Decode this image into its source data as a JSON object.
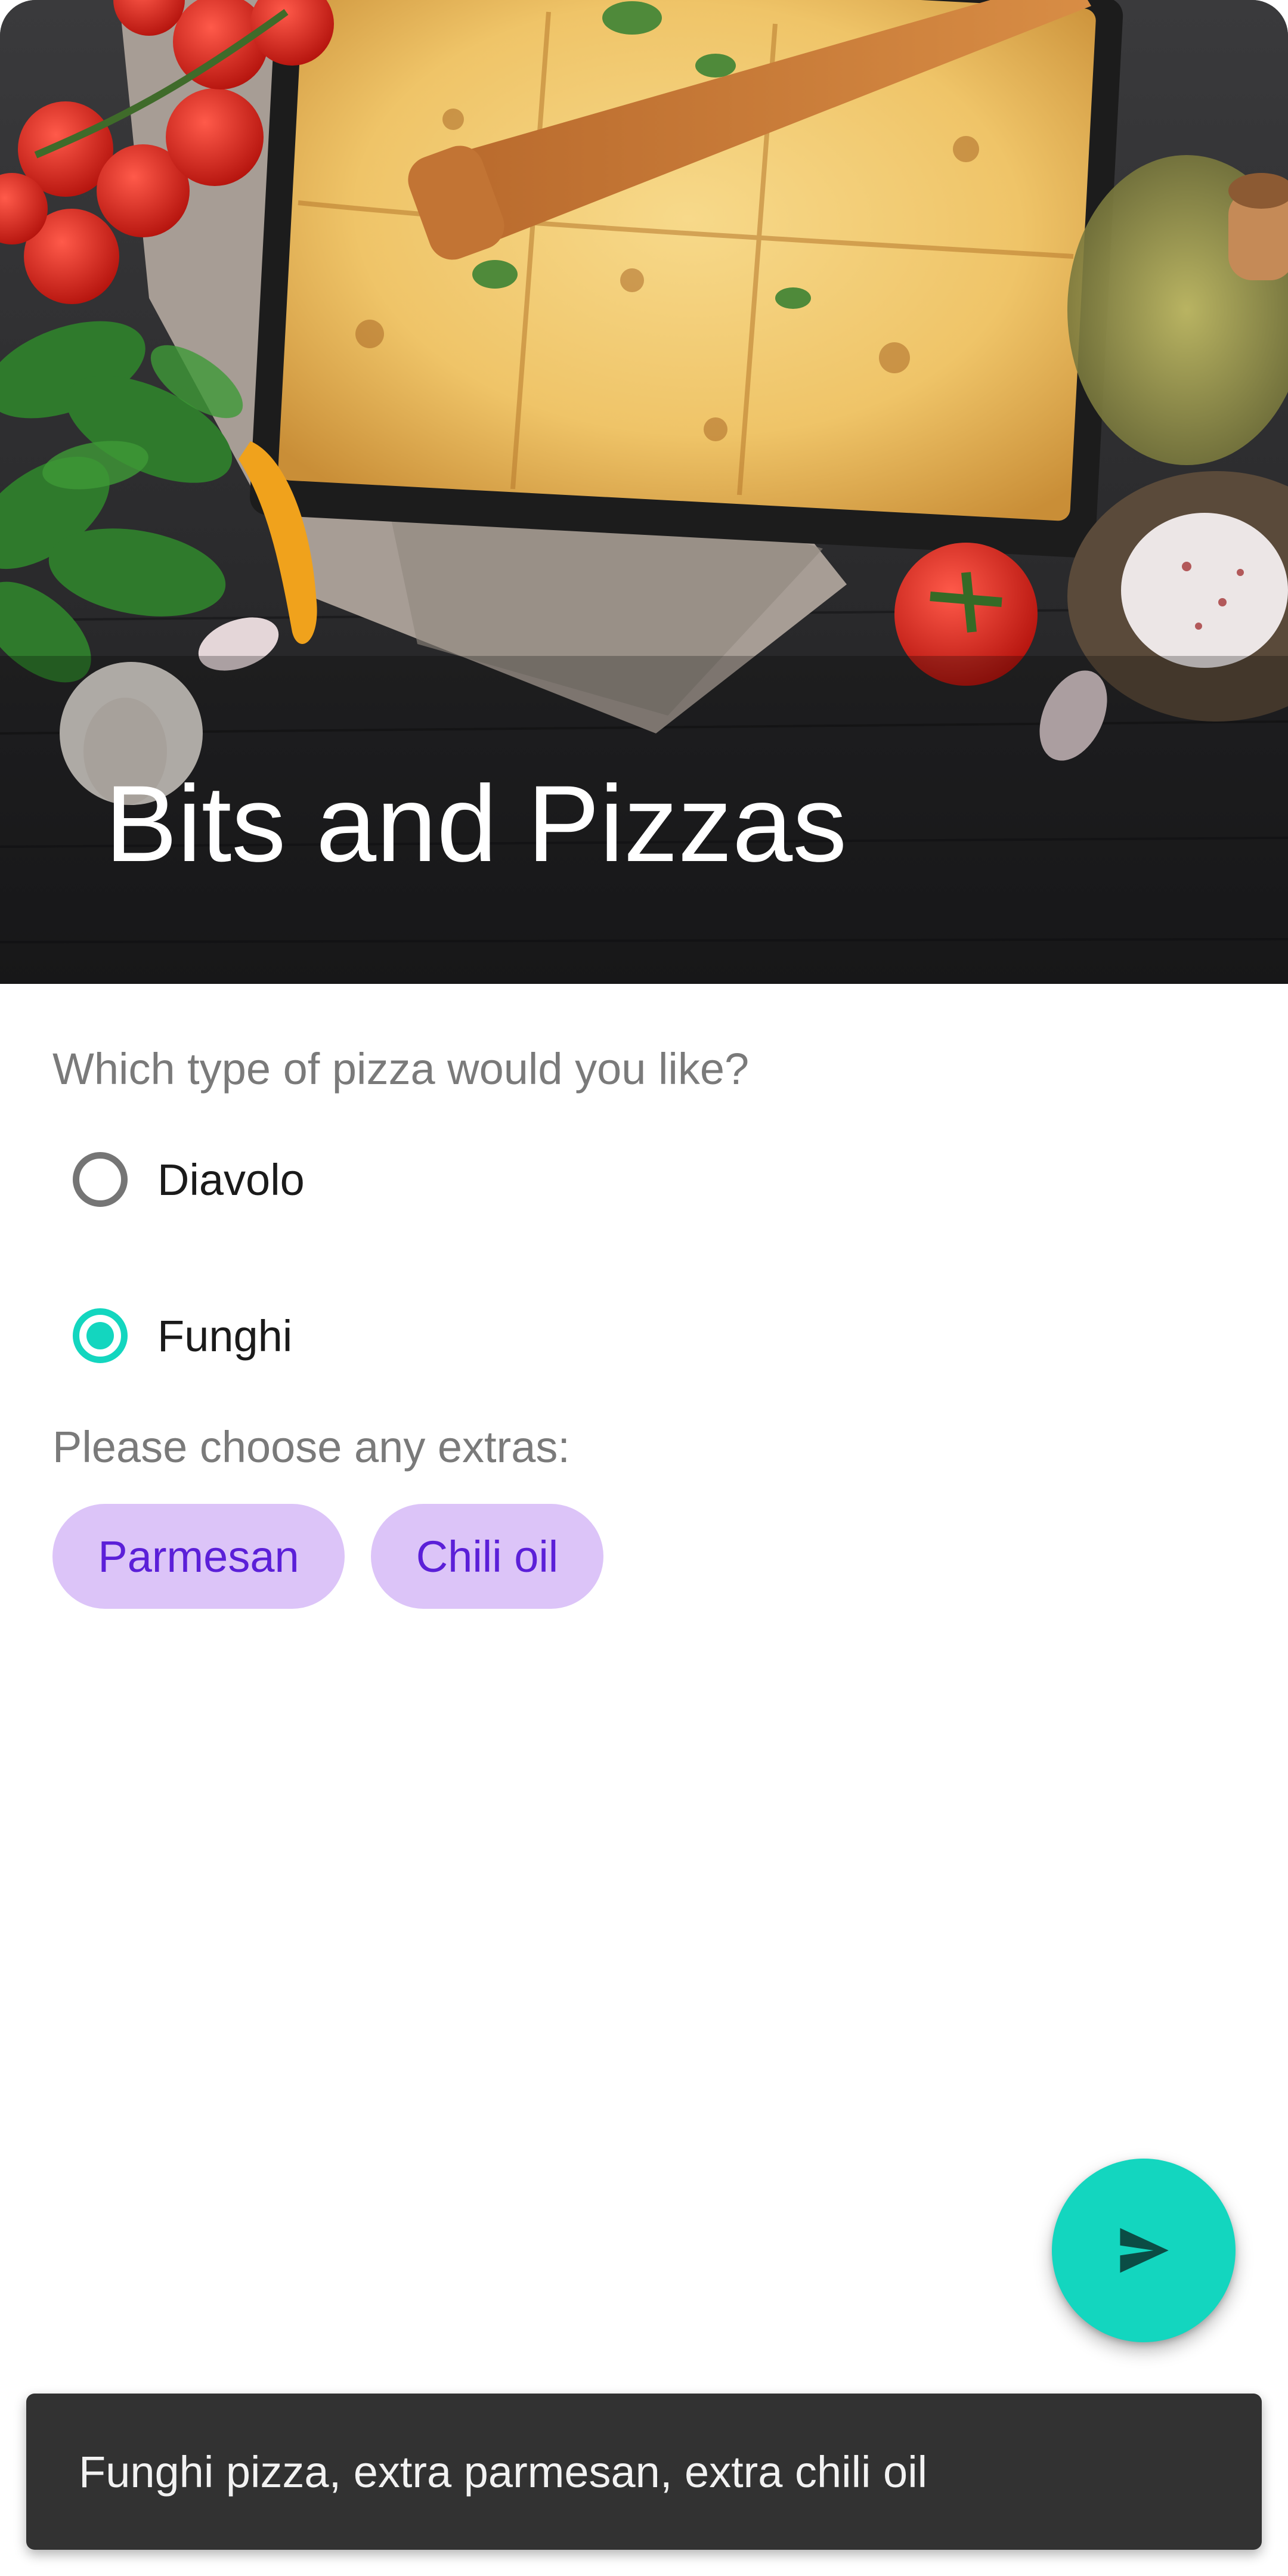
{
  "header": {
    "title": "Bits and Pizzas"
  },
  "pizza": {
    "question": "Which type of pizza would you like?",
    "options": [
      {
        "label": "Diavolo",
        "selected": false
      },
      {
        "label": "Funghi",
        "selected": true
      }
    ]
  },
  "extras": {
    "label": "Please choose any extras:",
    "chips": [
      {
        "label": "Parmesan"
      },
      {
        "label": "Chili oil"
      }
    ]
  },
  "fab": {
    "icon": "send-icon"
  },
  "snackbar": {
    "message": "Funghi pizza, extra parmesan, extra chili oil"
  },
  "colors": {
    "accent": "#13d6bf",
    "chip_background": "#dcc4f8",
    "chip_text": "#5b1fd8",
    "snackbar_background": "#323232"
  }
}
